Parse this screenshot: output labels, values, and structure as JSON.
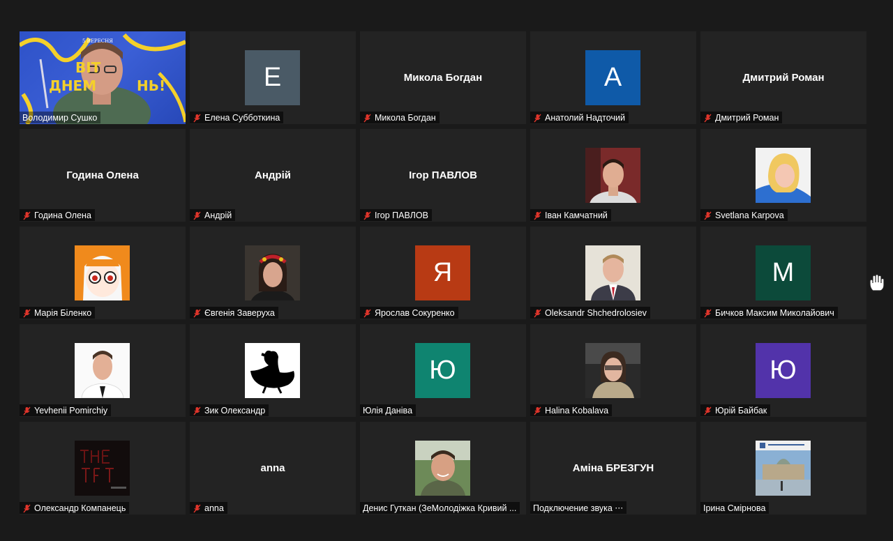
{
  "participants": [
    {
      "name": "Володимир Сушко",
      "type": "video",
      "muted": false,
      "banner_top": "5 ВЕРЕСНЯ",
      "banner_text1": "ВІТ",
      "banner_text2": "ДНЕМ",
      "banner_text3": "НЬ!"
    },
    {
      "name": "Елена Субботкина",
      "type": "letter",
      "letter": "E",
      "color": "#4a5a66",
      "muted": true
    },
    {
      "name": "Микола Богдан",
      "type": "text",
      "center": "Микола Богдан",
      "muted": true
    },
    {
      "name": "Анатолий Надточий",
      "type": "letter",
      "letter": "A",
      "color": "#0f5aa8",
      "muted": true
    },
    {
      "name": "Дмитрий Роман",
      "type": "text",
      "center": "Дмитрий Роман",
      "muted": true
    },
    {
      "name": "Година Олена",
      "type": "text",
      "center": "Година Олена",
      "muted": true
    },
    {
      "name": "Андрій",
      "type": "text",
      "center": "Андрій",
      "muted": true
    },
    {
      "name": "Ігор ПАВЛОВ",
      "type": "text",
      "center": "Ігор ПАВЛОВ",
      "muted": true
    },
    {
      "name": "Іван Камчатний",
      "type": "photo",
      "photo": "man-red",
      "muted": true
    },
    {
      "name": "Svetlana Karpova",
      "type": "photo",
      "photo": "woman-blonde",
      "muted": true
    },
    {
      "name": "Марія Біленко",
      "type": "photo",
      "photo": "anime",
      "muted": true
    },
    {
      "name": "Євгенія Заверуха",
      "type": "photo",
      "photo": "woman-wreath",
      "muted": true
    },
    {
      "name": "Ярослав Сокуренко",
      "type": "letter",
      "letter": "Я",
      "color": "#b83a14",
      "muted": true
    },
    {
      "name": "Oleksandr Shchedrolosiev",
      "type": "photo",
      "photo": "man-suit",
      "muted": true
    },
    {
      "name": "Бичков Максим Миколайович",
      "type": "letter",
      "letter": "M",
      "color": "#0c4a3a",
      "muted": true
    },
    {
      "name": "Yevhenii Pomirchiy",
      "type": "photo",
      "photo": "man-white",
      "muted": true
    },
    {
      "name": "Зик Олександр",
      "type": "photo",
      "photo": "duck",
      "muted": true
    },
    {
      "name": "Юлія Данівa",
      "type": "letter",
      "letter": "Ю",
      "color": "#0f8470",
      "muted": false
    },
    {
      "name": "Halina Kobalava",
      "type": "photo",
      "photo": "woman-car",
      "muted": true
    },
    {
      "name": "Юрій Байбак",
      "type": "letter",
      "letter": "Ю",
      "color": "#5233aa",
      "muted": true
    },
    {
      "name": "Олександр Компанець",
      "type": "photo",
      "photo": "dark-poster",
      "muted": true
    },
    {
      "name": "anna",
      "type": "text",
      "center": "anna",
      "muted": true
    },
    {
      "name": "Денис Гуткан (ЗеМолодіжка Кривий ...",
      "type": "photo",
      "photo": "man-selfie",
      "muted": false
    },
    {
      "name": "Подключение звука ⋅⋅⋅",
      "type": "text",
      "center": "Аміна БРЕЗГУН",
      "muted": false
    },
    {
      "name": "Ірина Смірнова",
      "type": "photo",
      "photo": "building",
      "muted": false
    }
  ],
  "icons": {
    "muted": "mic-muted-icon",
    "raise_hand": "raised-hand-icon"
  },
  "colors": {
    "background": "#1a1a1a",
    "tile": "#232323",
    "muted_icon": "#e0352b"
  }
}
